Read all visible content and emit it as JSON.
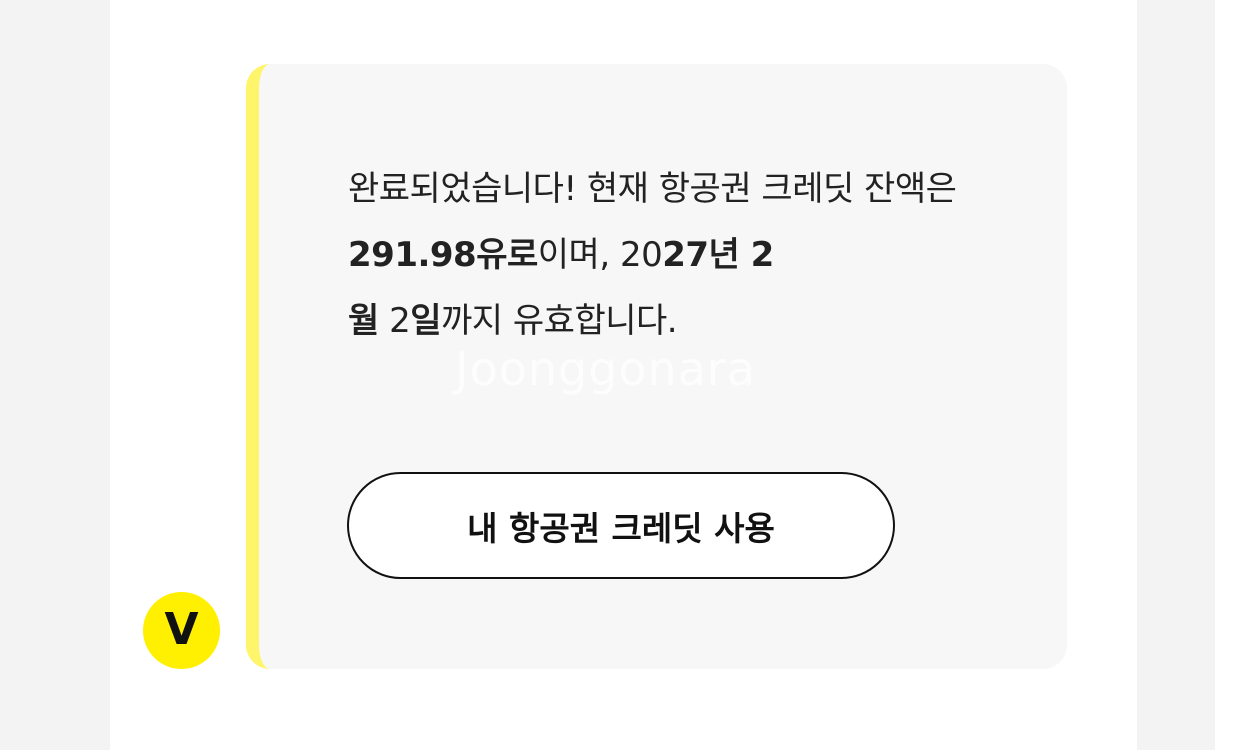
{
  "message": {
    "text_part1": "완료되었습니다! 현재 항공권 크레딧 잔액은 ",
    "amount": "291.98",
    "currency": "유로",
    "text_part2": "이며, 20",
    "year_digits": "27",
    "year_unit": "년 2",
    "month_unit": "월",
    "space_day_num": " 2",
    "day_unit": "일",
    "text_part3": "까지 유효합니다."
  },
  "watermark": "Joonggonara",
  "cta_button_label": "내 항공권 크레딧 사용",
  "avatar_letter": "V",
  "colors": {
    "bubble_bg": "#f7f7f7",
    "accent_yellow": "#fff56a",
    "avatar_yellow": "#ffef00",
    "text": "#222222"
  }
}
